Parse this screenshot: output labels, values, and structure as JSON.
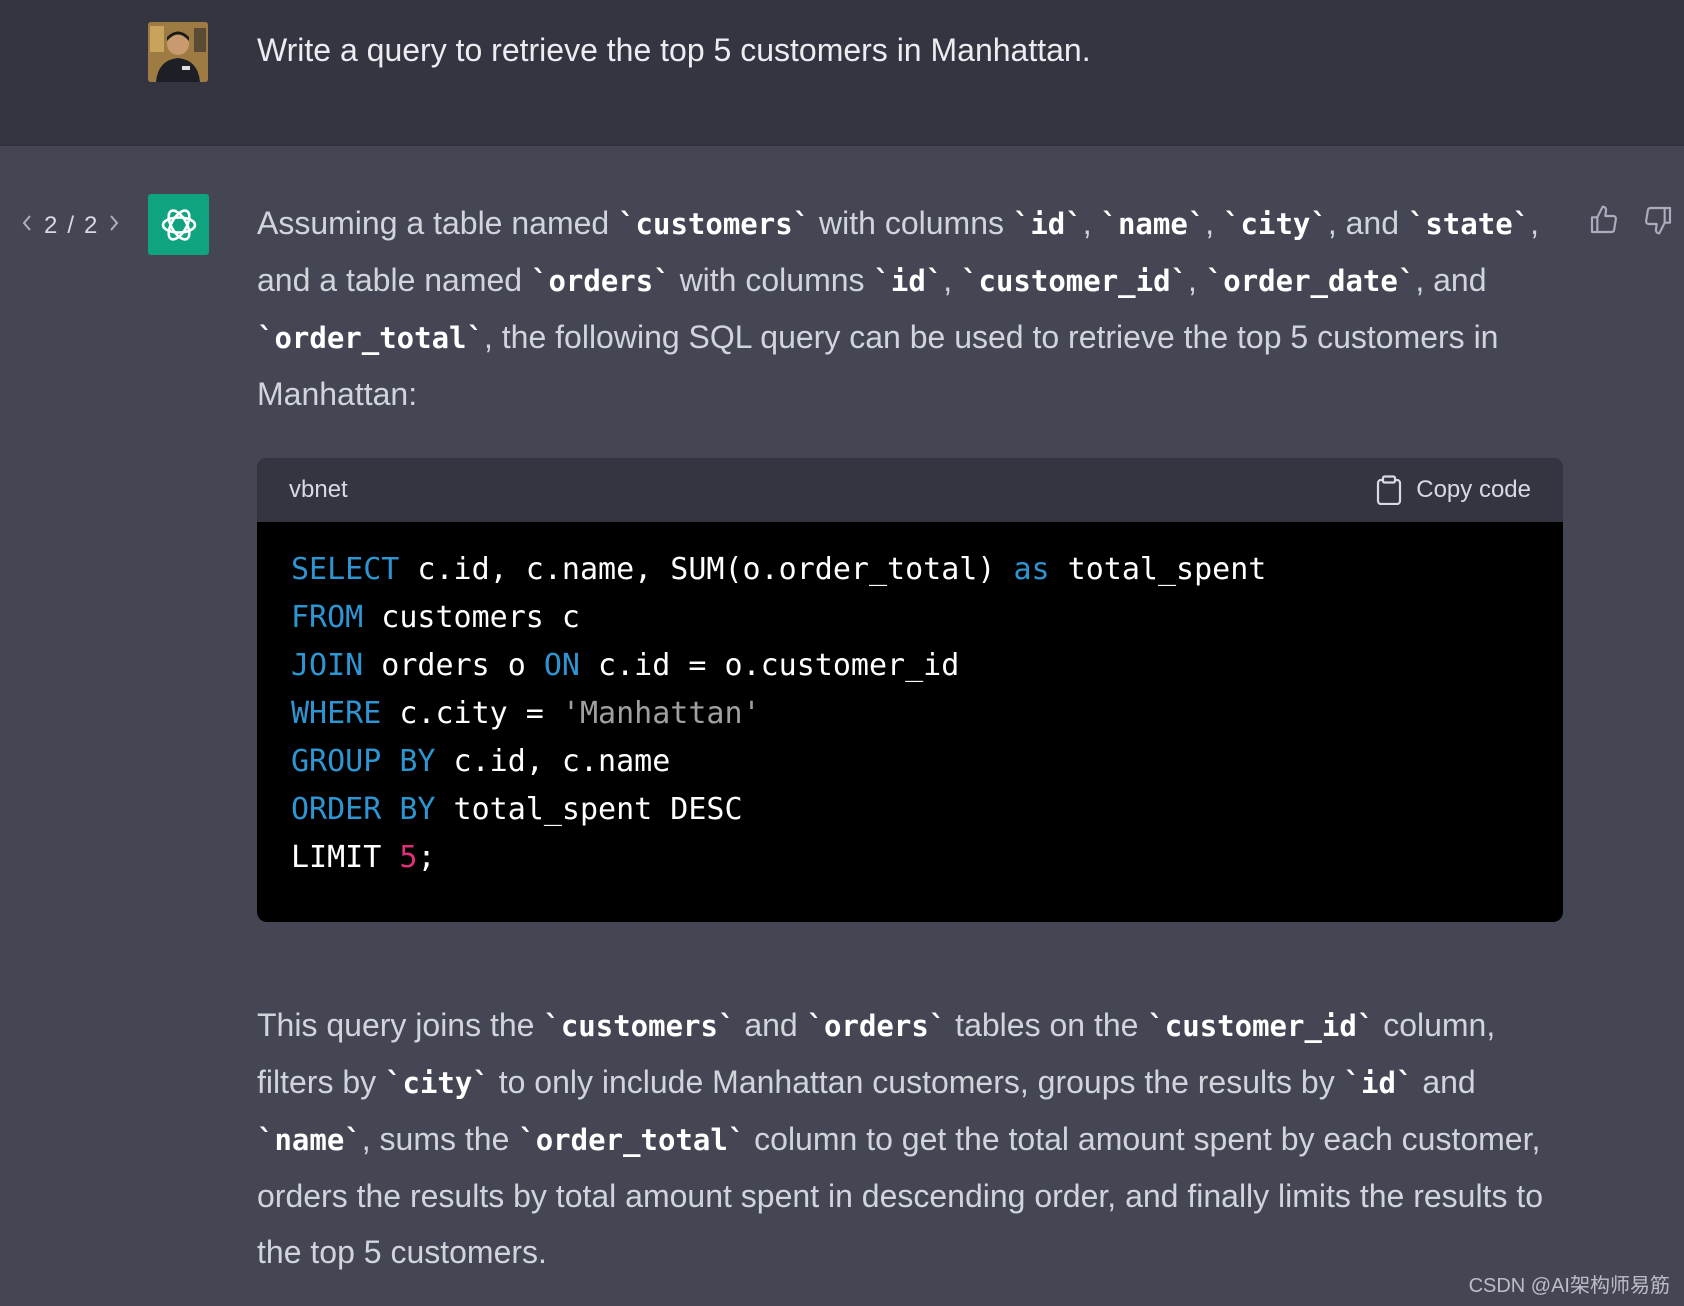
{
  "user": {
    "message": "Write a query to retrieve the top 5 customers in Manhattan."
  },
  "pager": {
    "current": "2",
    "separator": "/",
    "total": "2"
  },
  "answer": {
    "intro": [
      {
        "t": "text",
        "v": "Assuming a table named "
      },
      {
        "t": "code",
        "v": "`customers`"
      },
      {
        "t": "text",
        "v": " with columns "
      },
      {
        "t": "code",
        "v": "`id`"
      },
      {
        "t": "text",
        "v": ", "
      },
      {
        "t": "code",
        "v": "`name`"
      },
      {
        "t": "text",
        "v": ", "
      },
      {
        "t": "code",
        "v": "`city`"
      },
      {
        "t": "text",
        "v": ", and "
      },
      {
        "t": "code",
        "v": "`state`"
      },
      {
        "t": "text",
        "v": ", and a table named "
      },
      {
        "t": "code",
        "v": "`orders`"
      },
      {
        "t": "text",
        "v": " with columns "
      },
      {
        "t": "code",
        "v": "`id`"
      },
      {
        "t": "text",
        "v": ", "
      },
      {
        "t": "code",
        "v": "`customer_id`"
      },
      {
        "t": "text",
        "v": ", "
      },
      {
        "t": "code",
        "v": "`order_date`"
      },
      {
        "t": "text",
        "v": ", and "
      },
      {
        "t": "code",
        "v": "`order_total`"
      },
      {
        "t": "text",
        "v": ", the following SQL query can be used to retrieve the top 5 customers in Manhattan:"
      }
    ],
    "code": {
      "language": "vbnet",
      "copy_label": "Copy code",
      "lines": [
        [
          {
            "c": "kw",
            "v": "SELECT"
          },
          {
            "c": "",
            "v": " c.id, c.name, SUM(o.order_total) "
          },
          {
            "c": "kw",
            "v": "as"
          },
          {
            "c": "",
            "v": " total_spent"
          }
        ],
        [
          {
            "c": "kw",
            "v": "FROM"
          },
          {
            "c": "",
            "v": " customers c"
          }
        ],
        [
          {
            "c": "kw",
            "v": "JOIN"
          },
          {
            "c": "",
            "v": " orders o "
          },
          {
            "c": "kw",
            "v": "ON"
          },
          {
            "c": "",
            "v": " c.id = o.customer_id"
          }
        ],
        [
          {
            "c": "kw",
            "v": "WHERE"
          },
          {
            "c": "",
            "v": " c.city = "
          },
          {
            "c": "str",
            "v": "'Manhattan'"
          }
        ],
        [
          {
            "c": "kw",
            "v": "GROUP"
          },
          {
            "c": "",
            "v": " "
          },
          {
            "c": "kw",
            "v": "BY"
          },
          {
            "c": "",
            "v": " c.id, c.name"
          }
        ],
        [
          {
            "c": "kw",
            "v": "ORDER"
          },
          {
            "c": "",
            "v": " "
          },
          {
            "c": "kw",
            "v": "BY"
          },
          {
            "c": "",
            "v": " total_spent DESC"
          }
        ],
        [
          {
            "c": "",
            "v": "LIMIT "
          },
          {
            "c": "num",
            "v": "5"
          },
          {
            "c": "",
            "v": ";"
          }
        ]
      ]
    },
    "outro": [
      {
        "t": "text",
        "v": "This query joins the "
      },
      {
        "t": "code",
        "v": "`customers`"
      },
      {
        "t": "text",
        "v": " and "
      },
      {
        "t": "code",
        "v": "`orders`"
      },
      {
        "t": "text",
        "v": " tables on the "
      },
      {
        "t": "code",
        "v": "`customer_id`"
      },
      {
        "t": "text",
        "v": " column, filters by "
      },
      {
        "t": "code",
        "v": "`city`"
      },
      {
        "t": "text",
        "v": " to only include Manhattan customers, groups the results by "
      },
      {
        "t": "code",
        "v": "`id`"
      },
      {
        "t": "text",
        "v": " and "
      },
      {
        "t": "code",
        "v": "`name`"
      },
      {
        "t": "text",
        "v": ", sums the "
      },
      {
        "t": "code",
        "v": "`order_total`"
      },
      {
        "t": "text",
        "v": " column to get the total amount spent by each customer, orders the results by total amount spent in descending order, and finally limits the results to the top 5 customers."
      }
    ]
  },
  "watermark": "CSDN @AI架构师易筋",
  "colors": {
    "user_bg": "#343541",
    "assistant_bg": "#444654",
    "bot_avatar": "#10a37f",
    "keyword": "#2e95d3",
    "string": "#a0a0a0",
    "number": "#df3079"
  },
  "icons": [
    "chevron-left-icon",
    "chevron-right-icon",
    "openai-logo-icon",
    "clipboard-icon",
    "thumbs-up-icon",
    "thumbs-down-icon"
  ]
}
